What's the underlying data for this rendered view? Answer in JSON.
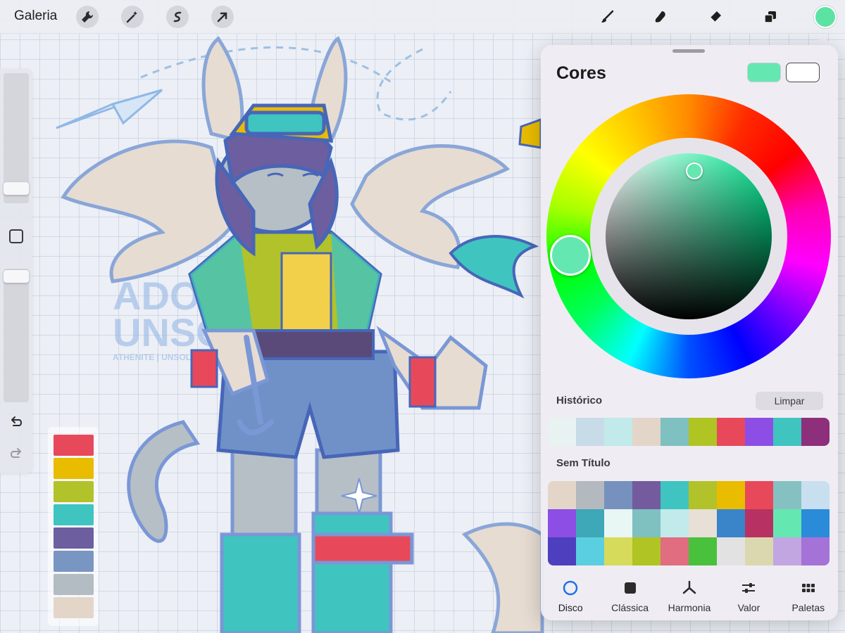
{
  "toolbar": {
    "gallery_label": "Galeria",
    "left_icons": [
      "wrench-icon",
      "magic-wand-icon",
      "selection-icon",
      "transform-arrow-icon"
    ],
    "right_icons": [
      "brush-icon",
      "smudge-icon",
      "eraser-icon",
      "layers-icon"
    ],
    "current_color": "#5ce3a4"
  },
  "canvas_art": {
    "watermark_line1": "ADOPT",
    "watermark_line2": "UNSOLD",
    "watermark_line3": "ATHENITE | UNSOLD ADOPT"
  },
  "canvas_palette": [
    "#e8495a",
    "#e9bc00",
    "#b2c22a",
    "#3fc4c0",
    "#6d5ea0",
    "#7996c3",
    "#b3bcc2",
    "#e3d6c9"
  ],
  "color_panel": {
    "title": "Cores",
    "primary_color": "#64e7b1",
    "secondary_color": "#ffffff",
    "history_label": "Histórico",
    "clear_label": "Limpar",
    "history": [
      "#e8f3f1",
      "#c8dbe8",
      "#c2eaea",
      "#e3d6c9",
      "#7fc0c0",
      "#b0c424",
      "#e8495a",
      "#8c4ee4",
      "#3fc4c0",
      "#8d2f7a"
    ],
    "palette_name": "Sem Título",
    "palette": [
      "#e3d6c9",
      "#b4b9bf",
      "#7691bd",
      "#735b9e",
      "#3fc4c0",
      "#b2c22a",
      "#e9bc00",
      "#e8495a",
      "#86c1c2",
      "#c8dff0",
      "#8c4ee4",
      "#3ea7b8",
      "#e8f6f4",
      "#7fc0c1",
      "#c2eaea",
      "#e8dfd6",
      "#3a84c9",
      "#b73262",
      "#64e7b1",
      "#2a8bd9",
      "#4e3fbe",
      "#5acfe0",
      "#d6db5c",
      "#b0c424",
      "#e06d80",
      "#4ac13d",
      "#e2e2e2",
      "#dbd8b0",
      "#c1a6e2",
      "#a572d8"
    ],
    "tabs": [
      {
        "label": "Disco",
        "icon": "disc-icon",
        "active": true
      },
      {
        "label": "Clássica",
        "icon": "classic-square-icon",
        "active": false
      },
      {
        "label": "Harmonia",
        "icon": "harmony-icon",
        "active": false
      },
      {
        "label": "Valor",
        "icon": "sliders-icon",
        "active": false
      },
      {
        "label": "Paletas",
        "icon": "palettes-grid-icon",
        "active": false
      }
    ]
  }
}
